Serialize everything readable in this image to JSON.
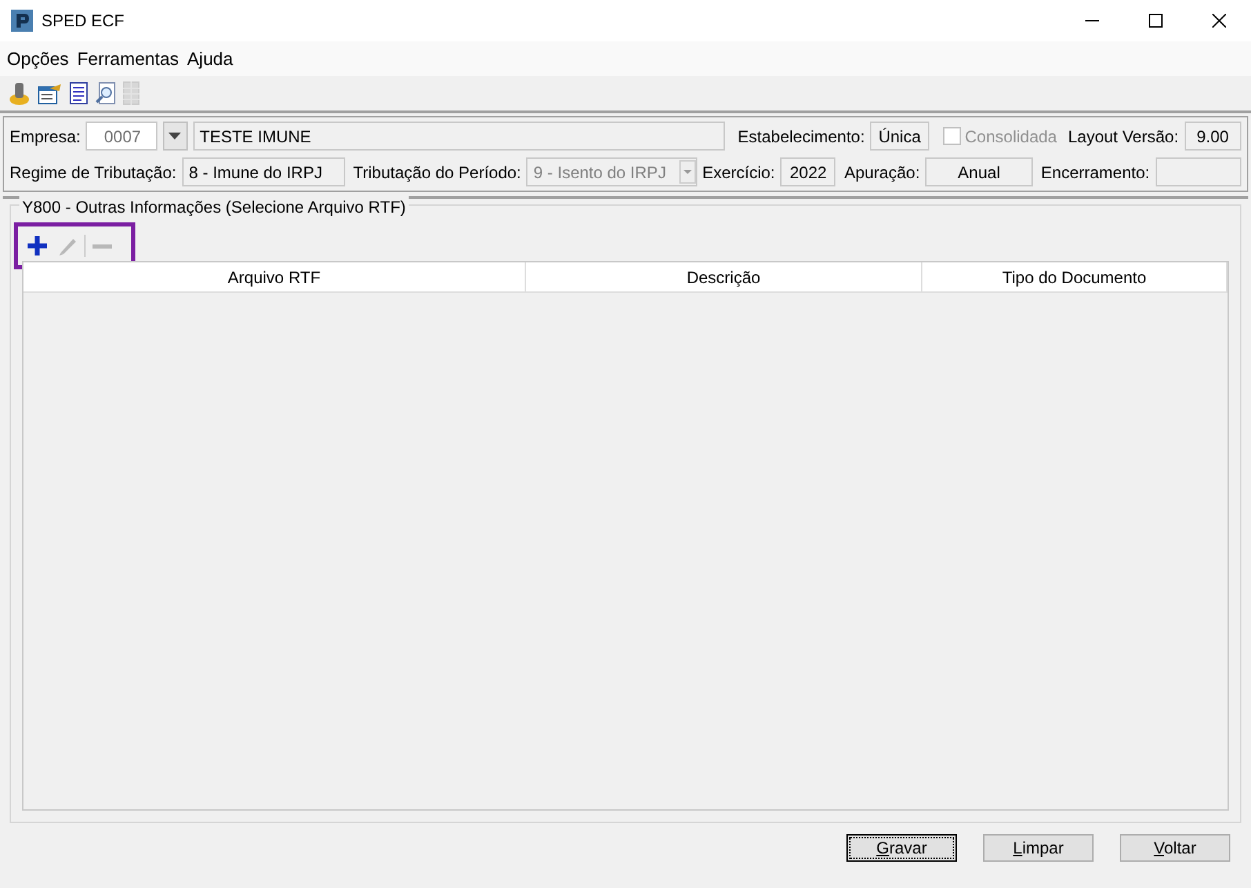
{
  "window": {
    "title": "SPED ECF"
  },
  "menu": [
    "Opções",
    "Ferramentas",
    "Ajuda"
  ],
  "toolbar": [
    {
      "kind": "plug",
      "disabled": false
    },
    {
      "kind": "settings",
      "disabled": false
    },
    {
      "kind": "document",
      "disabled": false
    },
    {
      "kind": "preview",
      "disabled": false
    },
    {
      "kind": "grid",
      "disabled": true
    }
  ],
  "header": {
    "empresa_label": "Empresa:",
    "empresa_code": "0007",
    "empresa_name": "TESTE IMUNE",
    "estabelecimento_label": "Estabelecimento:",
    "estabelecimento": "Única",
    "consolidada": {
      "label": "Consolidada",
      "checked": false,
      "disabled": true
    },
    "layout_label": "Layout Versão:",
    "layout": "9.00",
    "regime_label": "Regime de Tributação:",
    "regime": "8 - Imune do IRPJ",
    "tributacao_label": "Tributação do Período:",
    "tributacao": "9 - Isento do IRPJ",
    "exercicio_label": "Exercício:",
    "exercicio": "2022",
    "apuracao_label": "Apuração:",
    "apuracao": "Anual",
    "encerramento_label": "Encerramento:"
  },
  "group": {
    "title": "Y800 - Outras Informações (Selecione Arquivo RTF)",
    "actions": [
      {
        "kind": "add",
        "disabled": false
      },
      {
        "kind": "edit",
        "disabled": true
      },
      {
        "kind": "remove",
        "disabled": true
      }
    ],
    "columns": [
      "Arquivo RTF",
      "Descrição",
      "Tipo do Documento"
    ]
  },
  "buttons": [
    {
      "label": "Gravar",
      "focused": true
    },
    {
      "label": "Limpar",
      "focused": false
    },
    {
      "label": "Voltar",
      "focused": false
    }
  ]
}
